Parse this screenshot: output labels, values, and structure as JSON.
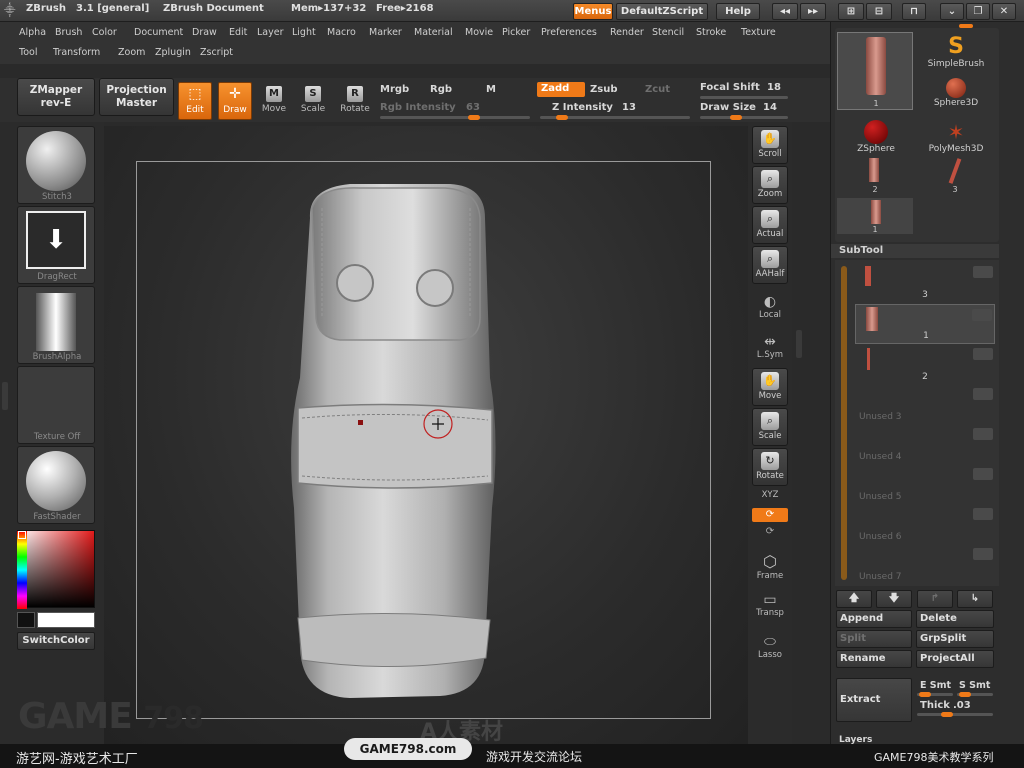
{
  "titlebar": {
    "app_name": "ZBrush",
    "version": "3.1 [general]",
    "document": "ZBrush Document",
    "mem": "Mem▸137+32",
    "free": "Free▸2168",
    "menus_btn": "Menus",
    "script_btn": "DefaultZScript",
    "help_btn": "Help"
  },
  "menubar": {
    "row1": [
      "Alpha",
      "Brush",
      "Color",
      "Document",
      "Draw",
      "Edit",
      "Layer",
      "Light",
      "Macro",
      "Marker",
      "Material",
      "Movie",
      "Picker",
      "Preferences",
      "Render",
      "Stencil",
      "Stroke",
      "Texture"
    ],
    "row2": [
      "Tool",
      "Transform",
      "Zoom",
      "Zplugin",
      "Zscript"
    ]
  },
  "toolbar": {
    "zmapper_line1": "ZMapper",
    "zmapper_line2": "rev-E",
    "projection_line1": "Projection",
    "projection_line2": "Master",
    "edit": "Edit",
    "draw": "Draw",
    "move": "Move",
    "scale": "Scale",
    "rotate": "Rotate",
    "mrgb": "Mrgb",
    "rgb": "Rgb",
    "m": "M",
    "rgb_intensity_label": "Rgb Intensity",
    "rgb_intensity_value": "63",
    "zadd": "Zadd",
    "zsub": "Zsub",
    "zcut": "Zcut",
    "z_intensity_label": "Z Intensity",
    "z_intensity_value": "13",
    "focal_shift_label": "Focal Shift",
    "focal_shift_value": "18",
    "draw_size_label": "Draw Size",
    "draw_size_value": "14"
  },
  "left_shelf": {
    "material": "Stitch3",
    "stroke": "DragRect",
    "alpha": "BrushAlpha",
    "texture": "Texture Off",
    "shader": "FastShader",
    "switch_color": "SwitchColor"
  },
  "right_shelf": {
    "scroll": "Scroll",
    "zoom": "Zoom",
    "actual": "Actual",
    "aahalf": "AAHalf",
    "local": "Local",
    "lsym": "L.Sym",
    "move": "Move",
    "scale": "Scale",
    "rotate": "Rotate",
    "xyz": "XYZ",
    "frame": "Frame",
    "transp": "Transp",
    "lasso": "Lasso"
  },
  "tool_palette": {
    "current_num": "1",
    "items": [
      "SimpleBrush",
      "Sphere3D",
      "ZSphere",
      "PolyMesh3D"
    ],
    "thumb_nums": [
      "2",
      "3",
      "1"
    ]
  },
  "subtool": {
    "header": "SubTool",
    "rows": [
      {
        "name": "3",
        "state": "normal"
      },
      {
        "name": "1",
        "state": "selected"
      },
      {
        "name": "2",
        "state": "normal"
      },
      {
        "name": "Unused  3",
        "state": "unused"
      },
      {
        "name": "Unused  4",
        "state": "unused"
      },
      {
        "name": "Unused  5",
        "state": "unused"
      },
      {
        "name": "Unused  6",
        "state": "unused"
      },
      {
        "name": "Unused  7",
        "state": "unused"
      }
    ],
    "append": "Append",
    "delete": "Delete",
    "split": "Split",
    "grpsplit": "GrpSplit",
    "rename": "Rename",
    "projectall": "ProjectAll",
    "extract": "Extract",
    "e_smt": "E Smt",
    "s_smt": "S Smt",
    "thick_label": "Thick",
    "thick_value": ".03",
    "layers_label": "Layers"
  },
  "watermark": {
    "logo_text": "GAME",
    "logo_num": "798",
    "left_caption": "游艺网-游戏艺术工厂",
    "site": "GAME798.com",
    "forum": "游戏开发交流论坛",
    "right_caption": "GAME798美术教学系列",
    "center": "A人素材"
  },
  "colors": {
    "accent_orange": "#f07a18",
    "panel_bg": "#2d2d2d",
    "text": "#d8d8d8"
  }
}
